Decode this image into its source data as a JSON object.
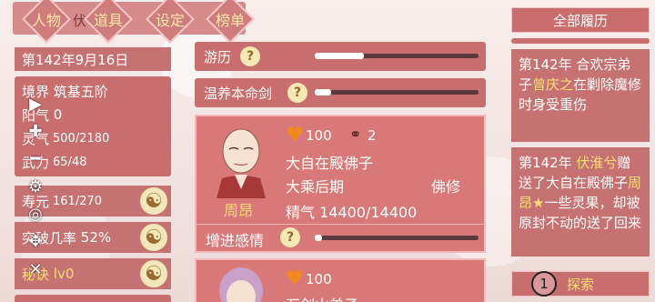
{
  "tabs": [
    "人物",
    "道具",
    "设定",
    "榜单"
  ],
  "header_partial": "伏",
  "date": "第142年9月16日",
  "stats": [
    {
      "label": "境界",
      "value": "筑基五阶"
    },
    {
      "label": "阳气",
      "value": "0"
    },
    {
      "label": "灵气",
      "value": "500/2180"
    },
    {
      "label": "武力",
      "value": "65/48"
    },
    {
      "label": "寿元",
      "value": "161/270"
    },
    {
      "label": "突破几率",
      "value": "52%"
    },
    {
      "label": "秘诀",
      "value": "lv0"
    }
  ],
  "sliders": [
    {
      "label": "游历",
      "level": 0.3
    },
    {
      "label": "温养本命剑",
      "level": 0.1
    }
  ],
  "character": {
    "name": "周昂",
    "affection": "100",
    "chain_count": "2",
    "sect": "大自在殿佛子",
    "realm": "大乘后期",
    "cultivation_type": "佛修",
    "essence": "精气 14400/14400",
    "increase_label": "增进感情",
    "increase_level": 0.05
  },
  "character2": {
    "affection": "100",
    "sect_partial": "万剑山弟子"
  },
  "right": {
    "history_button": "全部履历",
    "log1": [
      "第142年 合欢宗弟子",
      "曾庆之",
      "在剿除魔修时身受重伤"
    ],
    "log2": [
      "第142年 ",
      "伏淮兮",
      "赠送了大自在殿佛子",
      "周昂★",
      "一些灵果，却被原封不动的送了回来"
    ],
    "explore_button": "探索",
    "explore_number": "1"
  },
  "colors": {
    "panel": "#c77272",
    "gold": "#ffdd77",
    "card": "#d97878"
  }
}
